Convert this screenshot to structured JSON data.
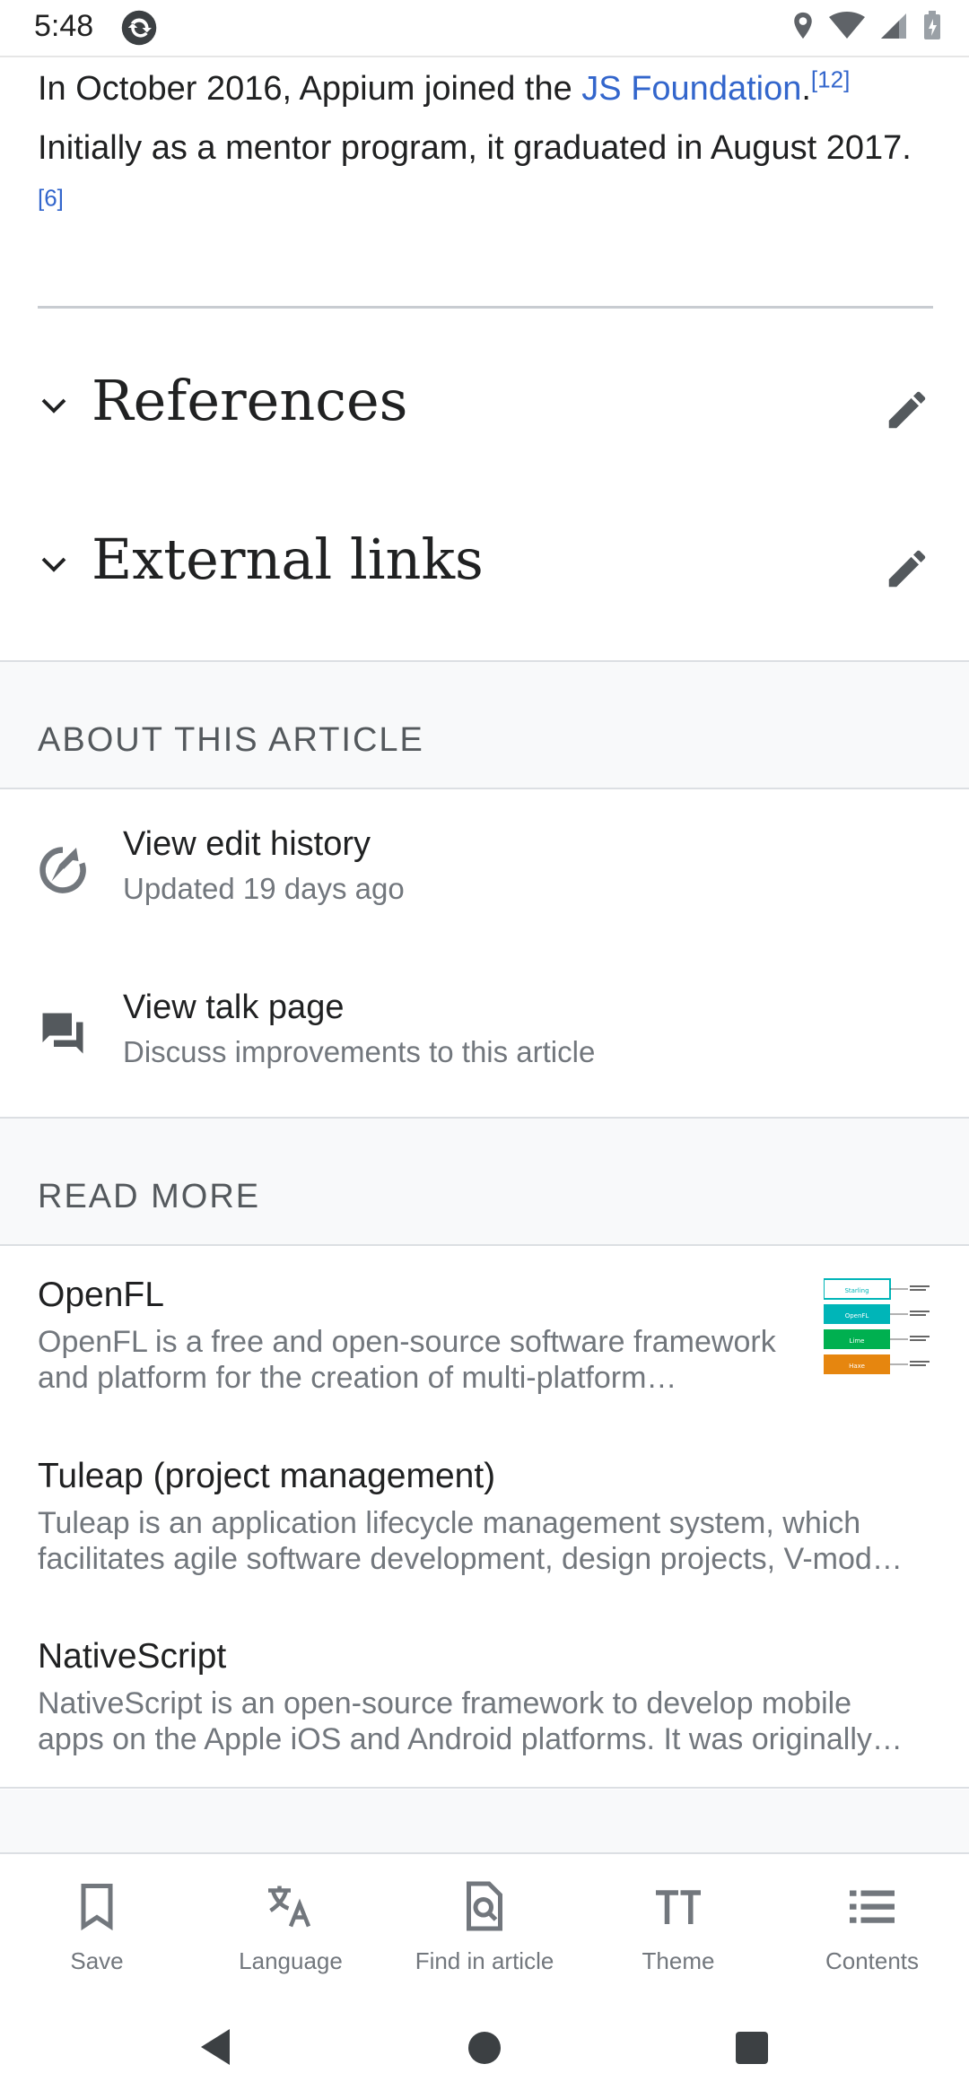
{
  "status": {
    "time": "5:48"
  },
  "article": {
    "line1_pre": "In October 2016, Appium joined the ",
    "line1_link": "JS Foundation",
    "line1_post": ".",
    "ref1": "[12]",
    "line2": "Initially as a mentor program, it graduated in August 2017. ",
    "ref2": "[6]"
  },
  "sections": [
    {
      "title": "References"
    },
    {
      "title": "External links"
    }
  ],
  "about": {
    "header": "ABOUT THIS ARTICLE",
    "edit_history": {
      "title": "View edit history",
      "subtitle": "Updated 19 days ago"
    },
    "talk": {
      "title": "View talk page",
      "subtitle": "Discuss improvements to this article"
    }
  },
  "read_more": {
    "header": "READ MORE",
    "items": [
      {
        "title": "OpenFL",
        "desc1": "OpenFL is a free and open-source software framework",
        "desc2": "and platform for the creation of multi-platform…"
      },
      {
        "title": "Tuleap (project management)",
        "desc1": "Tuleap is an application lifecycle management system, which",
        "desc2": "facilitates agile software development, design projects, V-mod…"
      },
      {
        "title": "NativeScript",
        "desc1": "NativeScript is an open-source framework to develop mobile",
        "desc2": "apps on the Apple iOS and Android platforms. It was originally…"
      }
    ],
    "thumb_labels": [
      "Starling",
      "OpenFL",
      "Lime",
      "Haxe"
    ]
  },
  "bottom_nav": [
    "Save",
    "Language",
    "Find in article",
    "Theme",
    "Contents"
  ],
  "colors": {
    "link": "#3366cc",
    "thumb": [
      "#ffffff",
      "#00b5b8",
      "#00b050",
      "#e6860f"
    ]
  }
}
